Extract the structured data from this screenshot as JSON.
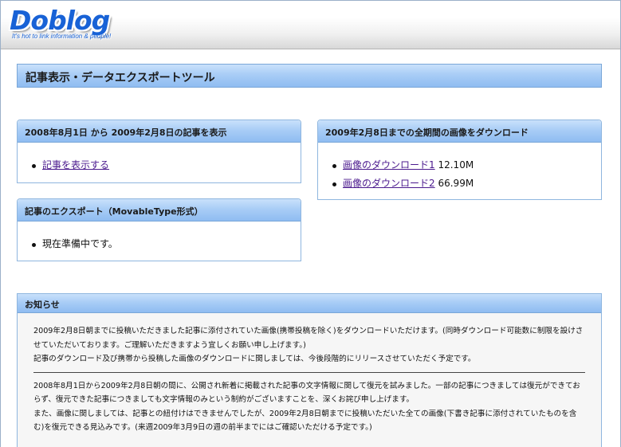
{
  "header": {
    "logo_text": "Doblog",
    "tagline": "It's hot to link information & people!"
  },
  "page_title": "記事表示・データエクスポートツール",
  "articles_box": {
    "title": "2008年8月1日 から 2009年2月8日の記事を表示",
    "items": [
      {
        "link": "記事を表示する"
      }
    ]
  },
  "export_box": {
    "title": "記事のエクスポート（MovableType形式）",
    "items": [
      {
        "text": "現在準備中です。"
      }
    ]
  },
  "images_box": {
    "title": "2009年2月8日までの全期間の画像をダウンロード",
    "items": [
      {
        "link": "画像のダウンロード1",
        "size": "12.10M"
      },
      {
        "link": "画像のダウンロード2",
        "size": "66.99M"
      }
    ]
  },
  "notice": {
    "title": "お知らせ",
    "paragraph1": "2009年2月8日朝までに投稿いただきました記事に添付されていた画像(携帯投稿を除く)をダウンロードいただけます。(同時ダウンロード可能数に制限を設けさせていただいております。ご理解いただきますよう宜しくお願い申し上げます。)",
    "paragraph2": "記事のダウンロード及び携帯から投稿した画像のダウンロードに関しましては、今後段階的にリリースさせていただく予定です。",
    "paragraph3": "2008年8月1日から2009年2月8日朝の間に、公開され新着に掲載された記事の文字情報に関して復元を試みました。一部の記事につきましては復元ができておらず、復元できた記事につきましても文字情報のみという制約がございますことを、深くお詫び申し上げます。",
    "paragraph4": "また、画像に関しましては、記事との紐付けはできませんでしたが、2009年2月8日朝までに投稿いただいた全ての画像(下書き記事に添付されていたものを含む)を復元できる見込みです。(来週2009年3月9日の週の前半までにはご確認いただける予定です。)"
  }
}
